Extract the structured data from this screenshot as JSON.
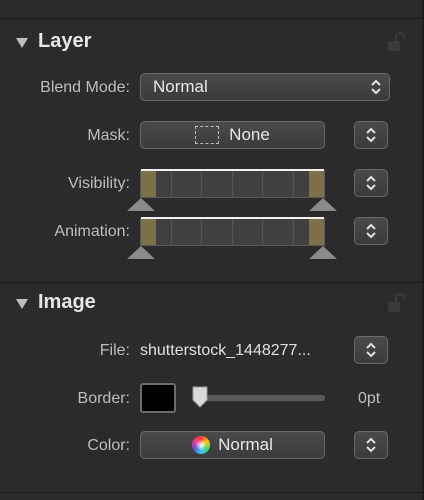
{
  "layer": {
    "title": "Layer",
    "blend_mode": {
      "label": "Blend Mode:",
      "value": "Normal"
    },
    "mask": {
      "label": "Mask:",
      "value": "None"
    },
    "visibility": {
      "label": "Visibility:"
    },
    "animation": {
      "label": "Animation:"
    }
  },
  "image": {
    "title": "Image",
    "file": {
      "label": "File:",
      "value": "shutterstock_1448277..."
    },
    "border": {
      "label": "Border:",
      "value": "0pt",
      "swatch_color": "#000000"
    },
    "color": {
      "label": "Color:",
      "value": "Normal"
    }
  },
  "colors": {
    "panel_bg": "#2b2b2b",
    "control_bg": "#3f3f3f",
    "range_end_fill": "#7d6f48"
  }
}
